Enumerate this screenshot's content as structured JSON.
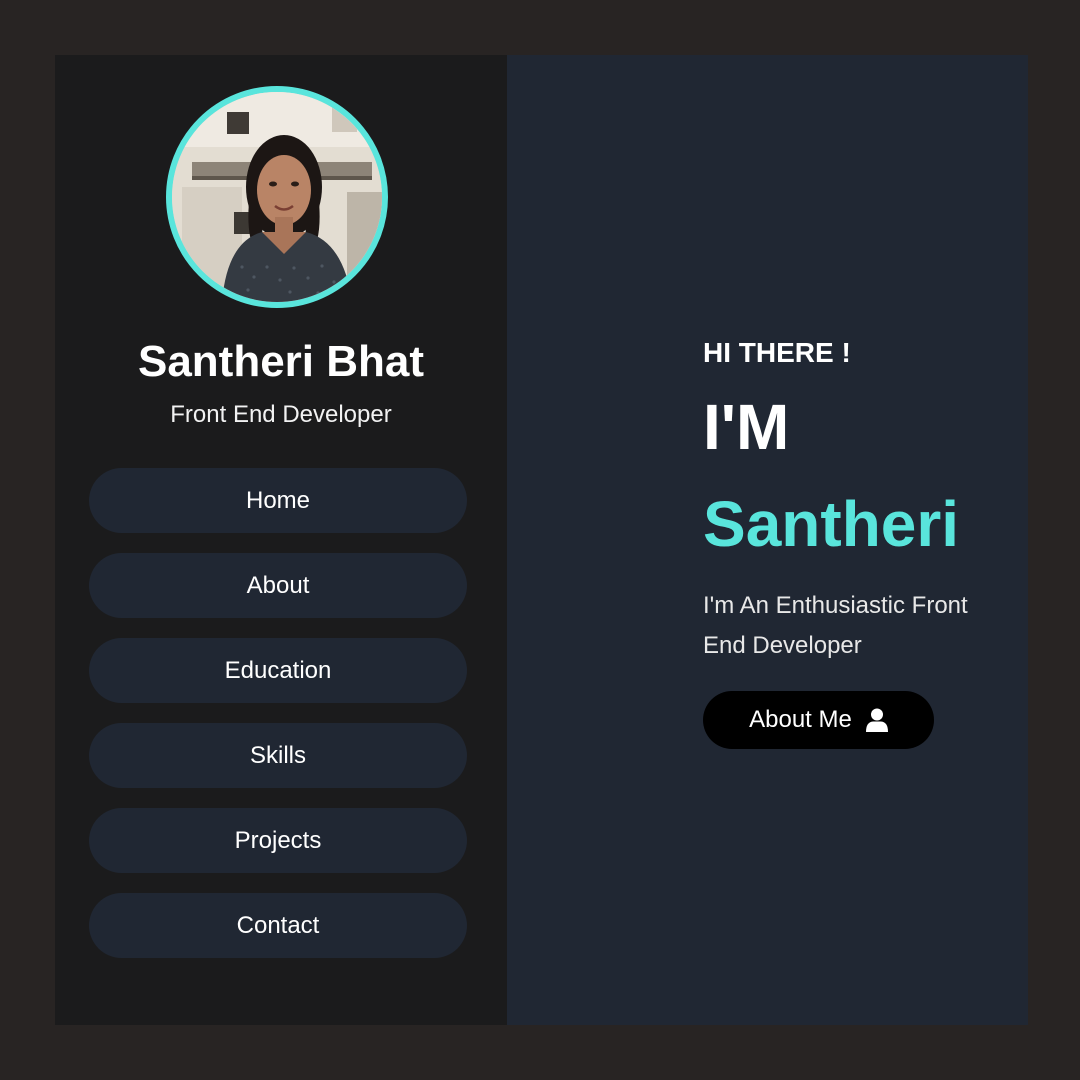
{
  "profile": {
    "name": "Santheri Bhat",
    "role": "Front End Developer"
  },
  "nav": {
    "items": [
      {
        "label": "Home"
      },
      {
        "label": "About"
      },
      {
        "label": "Education"
      },
      {
        "label": "Skills"
      },
      {
        "label": "Projects"
      },
      {
        "label": "Contact"
      }
    ]
  },
  "hero": {
    "greeting": "HI THERE !",
    "im": "I'M",
    "first_name": "Santheri",
    "tagline": "I'm An Enthusiastic Front End Developer",
    "cta_label": "About Me",
    "cta_icon": "user-icon"
  },
  "colors": {
    "accent": "#59e5dc",
    "page_bg": "#282423",
    "sidebar_bg": "#1b1b1c",
    "main_bg": "#202733",
    "button_bg": "#000000"
  }
}
